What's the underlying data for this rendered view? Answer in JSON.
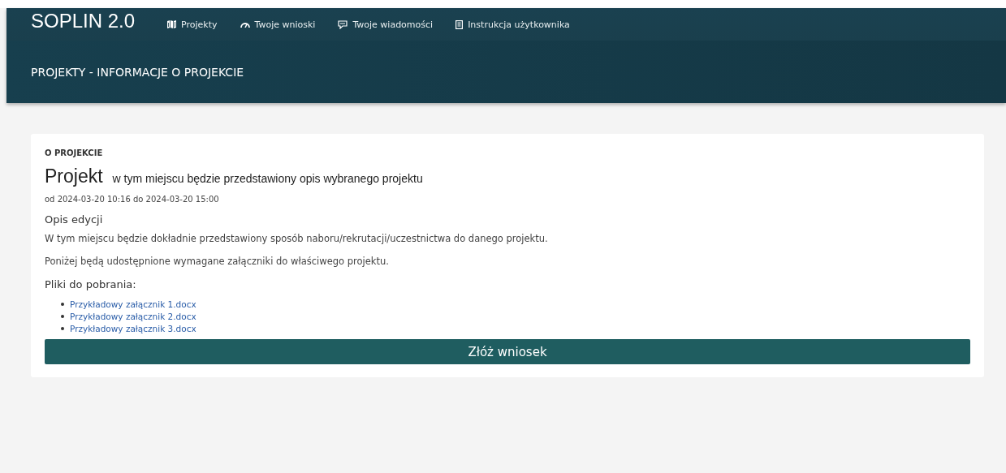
{
  "header": {
    "brand": "SOPLIN 2.0",
    "nav": [
      {
        "label": "Projekty",
        "kind": "map"
      },
      {
        "label": "Twoje wnioski",
        "kind": "gauge"
      },
      {
        "label": "Twoje wiadomości",
        "kind": "chat"
      },
      {
        "label": "Instrukcja użytkownika",
        "kind": "book"
      }
    ],
    "page_title": "PROJEKTY - INFORMACJE O PROJEKCIE"
  },
  "card": {
    "section_label": "O PROJEKCIE",
    "title": "Projekt",
    "subtitle": "w tym miejscu będzie przedstawiony opis wybranego projektu",
    "dates": "od 2024-03-20 10:16 do 2024-03-20 15:00",
    "description_heading": "Opis edycji",
    "paragraphs": [
      "W tym miejscu będzie dokładnie przedstawiony sposób naboru/rekrutacji/uczestnictwa do danego projektu.",
      "Poniżej będą udostępnione wymagane załączniki do właściwego projektu."
    ],
    "files_heading": "Pliki do pobrania:",
    "files": [
      "Przykładowy załącznik 1.docx",
      "Przykładowy załącznik 2.docx",
      "Przykładowy załącznik 3.docx"
    ],
    "submit_button": "Złóż wniosek"
  }
}
